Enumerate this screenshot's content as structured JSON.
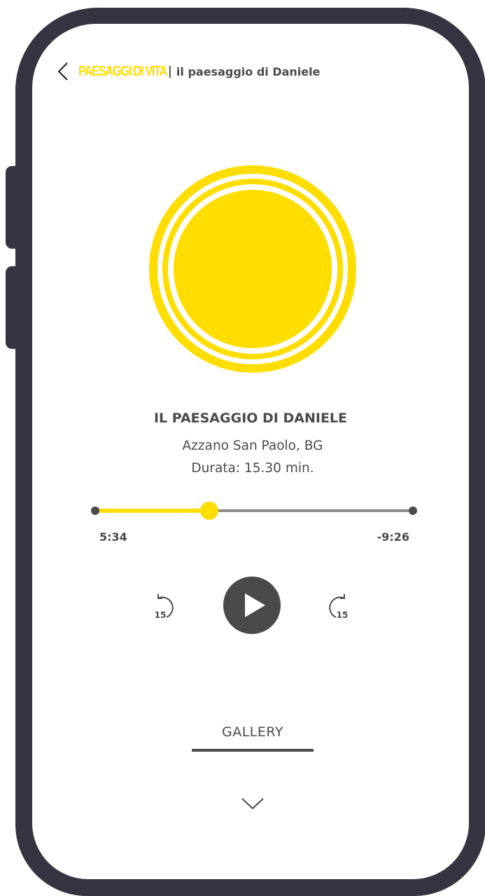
{
  "colors": {
    "accent": "#ffdd00",
    "frame": "#353441",
    "text": "#4a4a4a",
    "track": "#8c8c8c"
  },
  "header": {
    "back_icon": "chevron-left-icon",
    "brand": "PAESAGGI DI VITA",
    "separator": "|",
    "subtitle": "il paesaggio di Daniele"
  },
  "artwork": {
    "icon": "concentric-circles-artwork"
  },
  "track": {
    "title": "IL PAESAGGIO DI DANIELE",
    "location": "Azzano San Paolo, BG",
    "duration": "Durata: 15.30 min."
  },
  "player": {
    "elapsed": "5:34",
    "remaining": "-9:26",
    "progress": 0.36,
    "rewind_seconds": "15",
    "forward_seconds": "15",
    "play_icon": "play-icon",
    "rewind_icon": "rewind-15-icon",
    "forward_icon": "forward-15-icon"
  },
  "gallery": {
    "label": "GALLERY",
    "expand_icon": "chevron-down-icon"
  }
}
